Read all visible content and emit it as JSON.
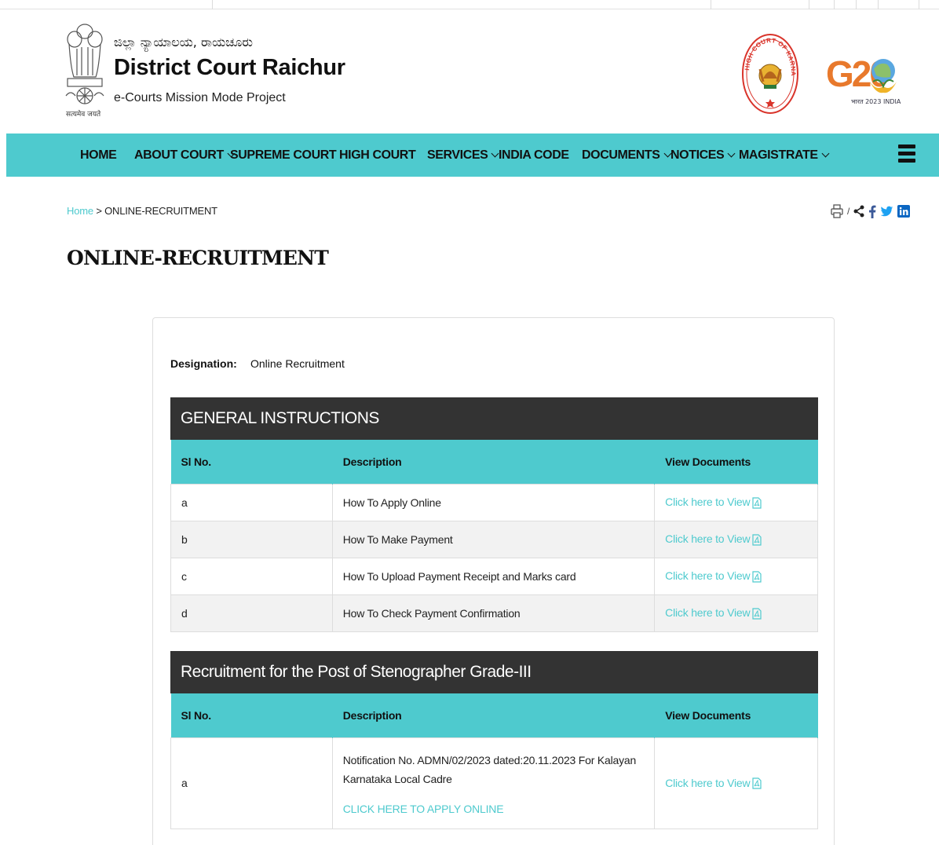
{
  "header": {
    "emblem_caption": "सत्यमेव जयते",
    "title_kn": "ಜಿಲ್ಲಾ ನ್ಯಾಯಾಲಯ, ರಾಯಚೂರು",
    "title": "District Court Raichur",
    "tagline": "e-Courts Mission Mode Project",
    "hc_logo_text": "HIGH COURT OF KARNATAKA",
    "g20_text": "G20",
    "g20_sub": "भारत 2023 INDIA"
  },
  "nav": {
    "home": "HOME",
    "about": "ABOUT COURT",
    "supreme": "SUPREME COURT",
    "high": "HIGH COURT",
    "services": "SERVICES",
    "indiacode": "INDIA CODE",
    "documents": "DOCUMENTS",
    "notices": "NOTICES",
    "magistrate": "MAGISTRATE"
  },
  "breadcrumb": {
    "home": "Home",
    "sep": ">",
    "current": "ONLINE-RECRUITMENT"
  },
  "share": {
    "divider": "/"
  },
  "page_title": "ONLINE-RECRUITMENT",
  "designation": {
    "label": "Designation:",
    "value": "Online Recruitment"
  },
  "section1": {
    "heading": "GENERAL INSTRUCTIONS",
    "columns": [
      "Sl No.",
      "Description",
      "View Documents"
    ],
    "rows": [
      {
        "sl": "a",
        "desc": "How To Apply Online",
        "link": "Click here to View"
      },
      {
        "sl": "b",
        "desc": "How To Make Payment",
        "link": "Click here to View"
      },
      {
        "sl": "c",
        "desc": "How To Upload Payment Receipt and Marks card",
        "link": "Click here to View"
      },
      {
        "sl": "d",
        "desc": "How To Check Payment Confirmation",
        "link": "Click here to View"
      }
    ]
  },
  "section2": {
    "heading": "Recruitment for the Post of Stenographer Grade-III",
    "columns": [
      "Sl No.",
      "Description",
      "View Documents"
    ],
    "rows": [
      {
        "sl": "a",
        "desc": "Notification No. ADMN/02/2023 dated:20.11.2023 For Kalayan Karnataka Local Cadre",
        "apply": "CLICK HERE TO APPLY ONLINE",
        "link": "Click here to View"
      }
    ]
  },
  "colors": {
    "accent": "#4ecace",
    "dark": "#333333"
  },
  "icons": [
    "emblem-icon",
    "high-court-logo",
    "g20-logo",
    "chevron-down-icon",
    "hamburger-menu-icon",
    "print-icon",
    "share-icon",
    "facebook-icon",
    "twitter-icon",
    "linkedin-icon",
    "pdf-icon"
  ]
}
